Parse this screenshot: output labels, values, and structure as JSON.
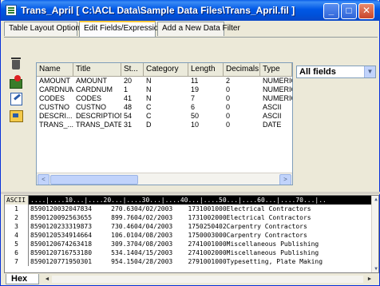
{
  "window": {
    "title": "Trans_April [ C:\\ACL Data\\Sample Data Files\\Trans_April.fil ]",
    "min_glyph": "_",
    "max_glyph": "□",
    "close_glyph": "✕"
  },
  "tabs": [
    {
      "label": "Table Layout Options",
      "active": false
    },
    {
      "label": "Edit Fields/Expressions",
      "active": true
    },
    {
      "label": "Add a New Data Filter",
      "active": false
    }
  ],
  "toolbar": {
    "icons": [
      "delete-icon",
      "add-field-icon",
      "edit-field-icon",
      "filter-icon"
    ]
  },
  "grid": {
    "columns": [
      "Name",
      "Title",
      "St...",
      "Category",
      "Length",
      "Decimals",
      "Type"
    ],
    "rows": [
      [
        "AMOUNT",
        "AMOUNT",
        "20",
        "N",
        "11",
        "2",
        "NUMERIC"
      ],
      [
        "CARDNUM",
        "CARDNUM",
        "1",
        "N",
        "19",
        "0",
        "NUMERIC"
      ],
      [
        "CODES",
        "CODES",
        "41",
        "N",
        "7",
        "0",
        "NUMERIC"
      ],
      [
        "CUSTNO",
        "CUSTNO",
        "48",
        "C",
        "6",
        "0",
        "ASCII"
      ],
      [
        "DESCRI...",
        "DESCRIPTION",
        "54",
        "C",
        "50",
        "0",
        "ASCII"
      ],
      [
        "TRANS_...",
        "TRANS_DATE",
        "31",
        "D",
        "10",
        "0",
        "DATE"
      ]
    ],
    "scroll_left": "<",
    "scroll_right": ">"
  },
  "filter_dropdown": {
    "value": "All fields",
    "arrow": "▼"
  },
  "dataview": {
    "encoding_label": "ASCII",
    "ruler": "....|....10...|....20...|....30...|....40...|....50...|....60...|....70...|..",
    "rows": [
      {
        "num": "1",
        "text": "8590120032047834     270.6304/02/2003    1731001000Electrical Contractors"
      },
      {
        "num": "2",
        "text": "8590120092563655     899.7604/02/2003    1731002000Electrical Contractors"
      },
      {
        "num": "3",
        "text": "8590120233319873     730.4604/04/2003    1750250402Carpentry Contractors"
      },
      {
        "num": "4",
        "text": "8590120534914664     106.0104/08/2003    1750003000Carpentry Contractors"
      },
      {
        "num": "5",
        "text": "8590120674263418     309.3704/08/2003    2741001000Miscellaneous Publishing"
      },
      {
        "num": "6",
        "text": "8590120716753180     534.1404/15/2003    2741002000Miscellaneous Publishing"
      },
      {
        "num": "7",
        "text": "8590120771950301     954.1504/28/2003    2791001000Typesetting, Plate Making"
      }
    ],
    "scroll_up": "▲",
    "scroll_down": "▼"
  },
  "bottom": {
    "view_tab": "Hex",
    "scroll_left": "◄",
    "scroll_right": "►"
  }
}
